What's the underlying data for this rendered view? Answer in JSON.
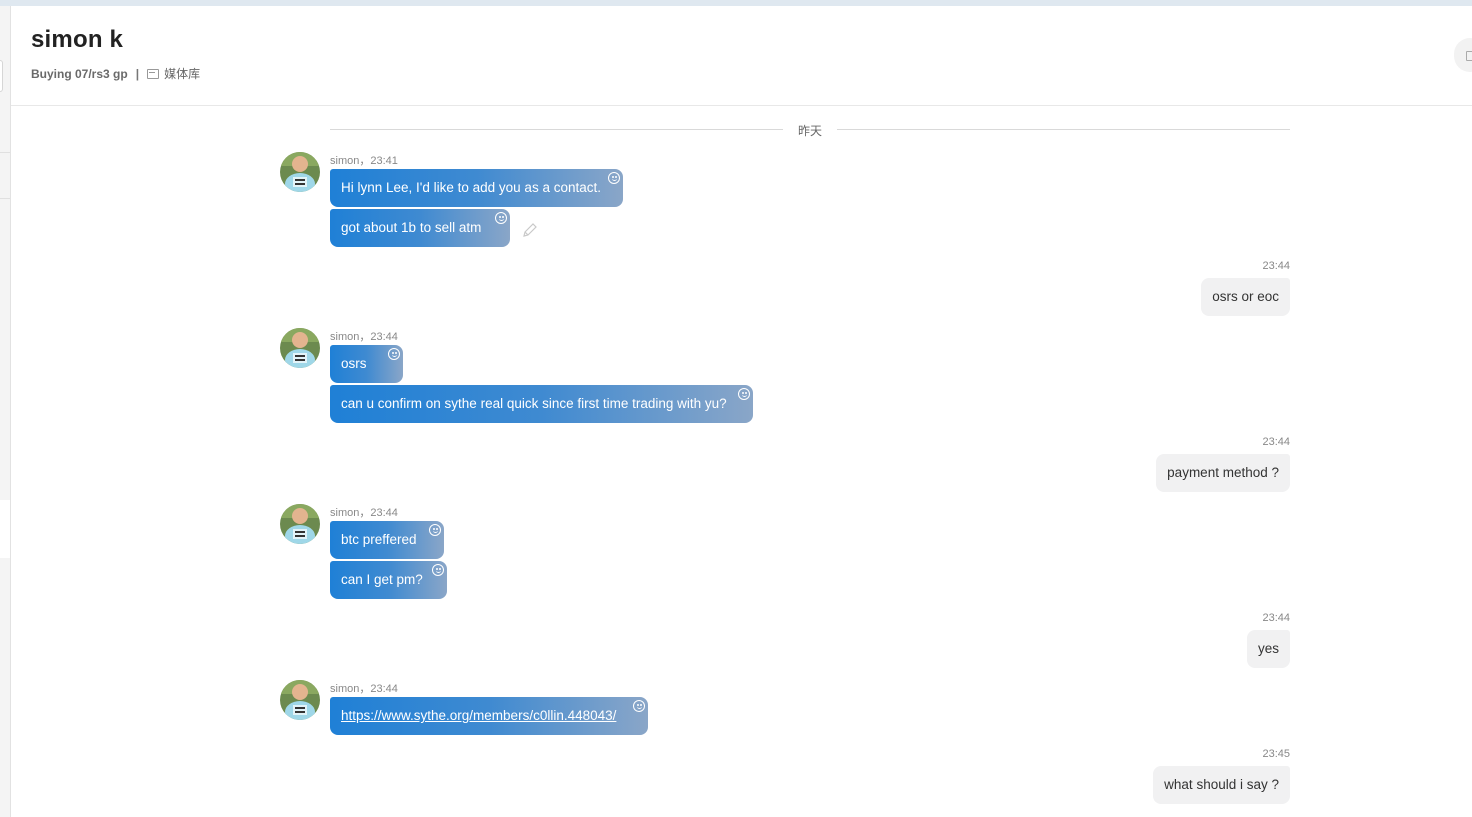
{
  "header": {
    "title": "simon k",
    "description": "Buying 07/rs3 gp",
    "separator": "|",
    "media_label": "媒体库"
  },
  "divider": {
    "label": "昨天"
  },
  "messages": [
    {
      "sender": "simon",
      "time": "23:41",
      "meta": "simon，23:41",
      "bubbles": [
        "Hi lynn Lee, I'd like to add you as a contact.",
        "got about 1b to sell atm"
      ]
    },
    {
      "outgoing_time": "23:44",
      "outgoing_text": "osrs or eoc"
    },
    {
      "sender": "simon",
      "time": "23:44",
      "meta": "simon，23:44",
      "bubbles": [
        "osrs",
        "can u confirm on sythe real quick since first time trading with yu?"
      ]
    },
    {
      "outgoing_time": "23:44",
      "outgoing_text": "payment method ?"
    },
    {
      "sender": "simon",
      "time": "23:44",
      "meta": "simon，23:44",
      "bubbles": [
        "btc preffered",
        "can I get pm?"
      ]
    },
    {
      "outgoing_time": "23:44",
      "outgoing_text": "yes"
    },
    {
      "sender": "simon",
      "time": "23:44",
      "meta": "simon，23:44",
      "link": "https://www.sythe.org/members/c0llin.448043/"
    },
    {
      "outgoing_time": "23:45",
      "outgoing_text": "what should i say ?"
    }
  ],
  "colors": {
    "incoming_bubble_start": "#1f80d6",
    "incoming_bubble_end": "#8aa6c8",
    "outgoing_bubble": "#f1f1f2"
  },
  "icons": [
    "media-icon",
    "emoji-icon",
    "edit-pencil-icon",
    "avatar"
  ]
}
